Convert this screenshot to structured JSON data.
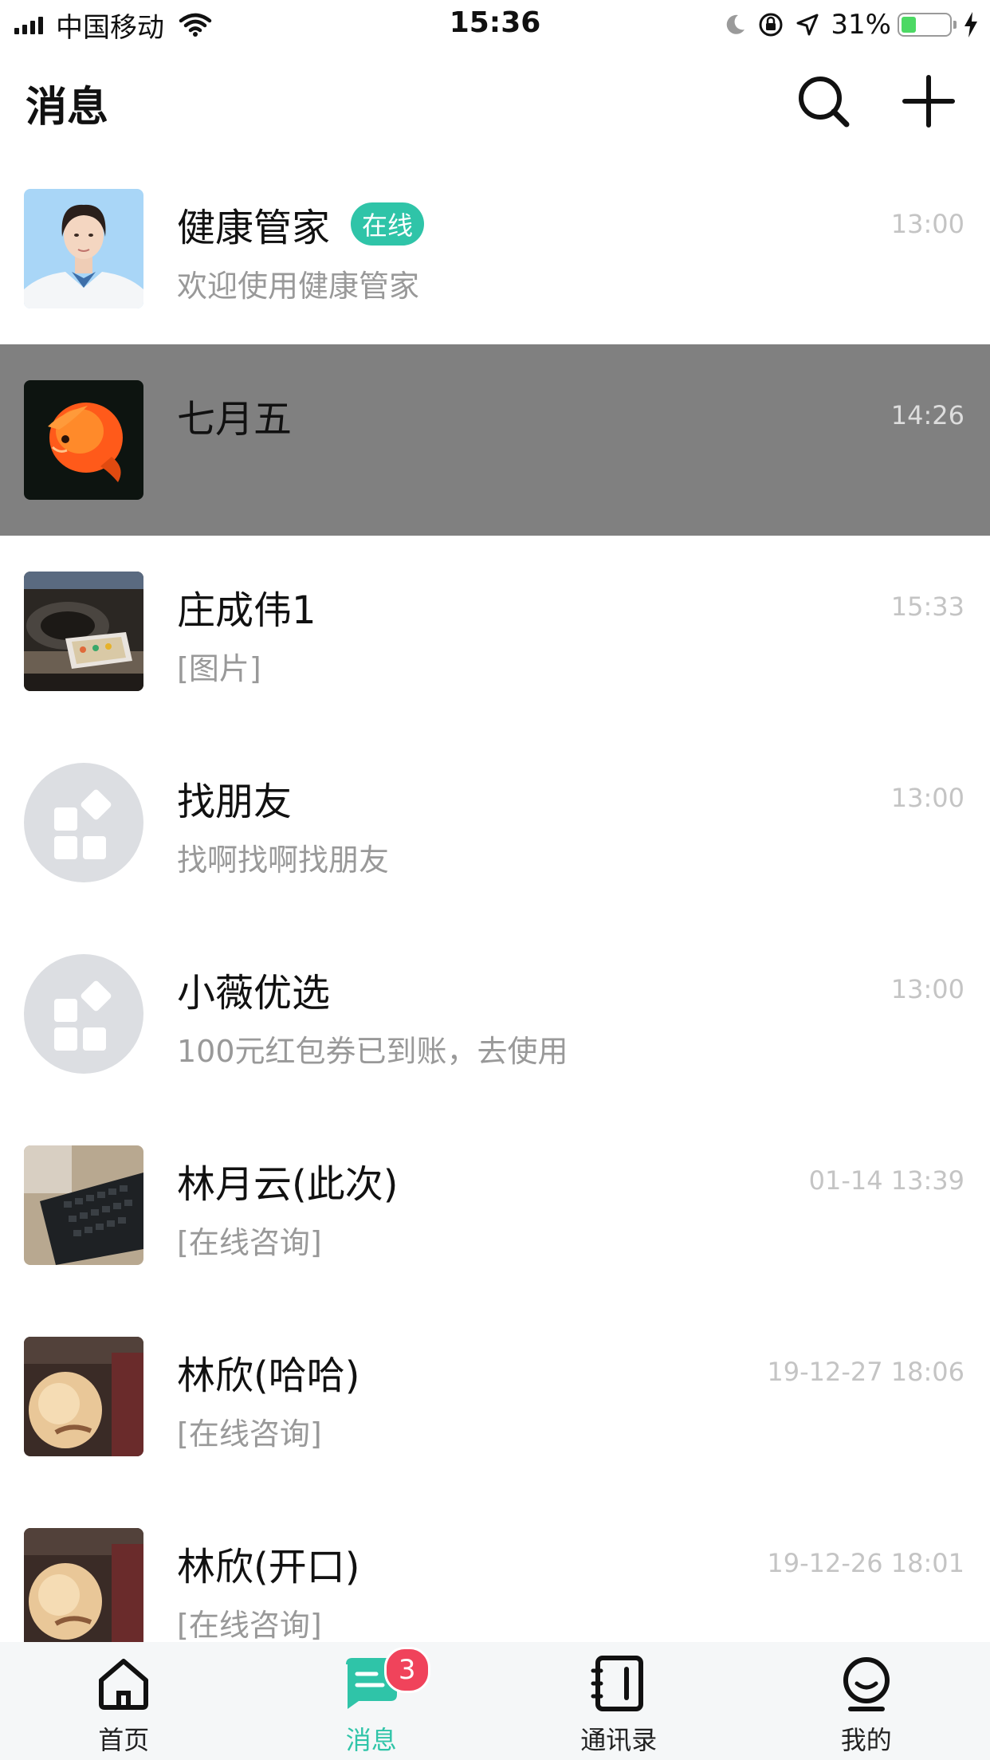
{
  "status_bar": {
    "carrier": "中国移动",
    "time": "15:36",
    "battery_percent_text": "31%",
    "battery_level": 0.31
  },
  "header": {
    "title": "消息",
    "icons": [
      "search-icon",
      "plus-icon"
    ]
  },
  "conversations": [
    {
      "name": "健康管家",
      "badge": "在线",
      "preview": "欢迎使用健康管家",
      "time": "13:00",
      "avatar": "photo"
    },
    {
      "name": "七月五",
      "badge": "",
      "preview": "",
      "time": "14:26",
      "avatar": "photo",
      "selected": true
    },
    {
      "name": "庄成伟1",
      "badge": "",
      "preview": "[图片]",
      "time": "15:33",
      "avatar": "photo"
    },
    {
      "name": "找朋友",
      "badge": "",
      "preview": "找啊找啊找朋友",
      "time": "13:00",
      "avatar": "apps-icon"
    },
    {
      "name": "小薇优选",
      "badge": "",
      "preview": "100元红包券已到账，去使用",
      "time": "13:00",
      "avatar": "apps-icon"
    },
    {
      "name": "林月云(此次)",
      "badge": "",
      "preview": "[在线咨询]",
      "time": "01-14 13:39",
      "avatar": "photo"
    },
    {
      "name": "林欣(哈哈)",
      "badge": "",
      "preview": "[在线咨询]",
      "time": "19-12-27 18:06",
      "avatar": "photo"
    },
    {
      "name": "林欣(开口)",
      "badge": "",
      "preview": "[在线咨询]",
      "time": "19-12-26 18:01",
      "avatar": "photo"
    }
  ],
  "tabbar": {
    "tabs": [
      {
        "label": "首页",
        "icon": "home-icon"
      },
      {
        "label": "消息",
        "icon": "message-icon",
        "badge": "3",
        "active": true
      },
      {
        "label": "通讯录",
        "icon": "contacts-icon"
      },
      {
        "label": "我的",
        "icon": "profile-icon"
      }
    ]
  },
  "colors": {
    "accent": "#2fc4a8",
    "badge": "#f0435b",
    "selected_row": "#808080",
    "secondary_text": "#999999"
  }
}
